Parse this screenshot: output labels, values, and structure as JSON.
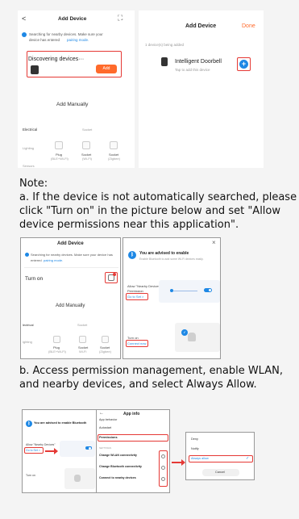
{
  "top_left": {
    "back": "<",
    "title": "Add Device",
    "scan": "⛶",
    "searching": "Searching for nearby devices. Make sure your",
    "searching2": "device has entered",
    "pairing_link": "pairing mode.",
    "discovering": "Discovering devices···",
    "add_btn": "Add",
    "add_manually": "Add Manually",
    "cat_electrical": "Electrical",
    "cat_socket": "Socket",
    "cat_lighting": "Lighting",
    "cat_sensors": "Sensors",
    "plug1": "Plug",
    "plug1_sub": "(BLE+Wi-Fi)",
    "plug2": "Socket",
    "plug2_sub": "(Wi-Fi)",
    "plug3": "Socket",
    "plug3_sub": "(Zigbee)"
  },
  "top_right": {
    "title": "Add Device",
    "done": "Done",
    "added": "1 device(s) being added",
    "device_name": "Intelligent Doorbell",
    "device_sub": "Tap to add this device",
    "add_icon": "+"
  },
  "note": {
    "heading": "Note:",
    "a_line1": "a. If the device is not automatically searched, please",
    "a_line2": "click \"Turn on\" in the picture below and set \"Allow",
    "a_line3": "device permissions near this application\".",
    "b_line1": "b. Access permission management, enable WLAN,",
    "b_line2": "and nearby devices, and select Always Allow."
  },
  "mid_left": {
    "title": "Add Device",
    "searching": "Searching for nearby devices. Make sure your device has",
    "searching2": "entered",
    "pairing_link": "pairing mode.",
    "turn_on": "Turn on",
    "add_manually": "Add Manually",
    "cat_electrical": "lectrical",
    "cat_socket": "Socket",
    "cat_lighting": "ighting",
    "plug1": "Plug",
    "plug1_sub": "(BLE+Wi-Fi)",
    "plug2": "Socket",
    "plug2_sub": "Wi-Fi",
    "plug3": "Socket",
    "plug3_sub": "(Zigbee)"
  },
  "mid_right": {
    "close": "×",
    "advised": "You are advised to enable",
    "advised_sub": "Enable Bluetooth to add some Wi-Fi devices easily.",
    "allow": "Allow \"Nearby Devices\"",
    "permission": "Permission",
    "go_to_set": "Go to Set >",
    "turn_on": "Turn on",
    "connect_now": "Connect now"
  },
  "bottom_left": {
    "advised": "You are advised to enable Bluetooth",
    "allow": "Allow \"Nearby Devices\"",
    "go_to_set": "Go to Set >",
    "turn_on": "Turn on"
  },
  "bottom_mid": {
    "back": "←",
    "title": "App info",
    "app_behavior": "App behavior",
    "autostart": "Autostart",
    "permissions": "Permissions",
    "settings": "SETTINGS",
    "wlan": "Change WLAN connectivity",
    "bluetooth": "Change Bluetooth connectivity",
    "nearby": "Connect to nearby devices"
  },
  "bottom_right": {
    "deny": "Deny",
    "notify": "Notify",
    "always_allow": "Always allow",
    "cancel": "Cancel"
  },
  "colors": {
    "accent_red": "#e53935",
    "orange": "#ff6a2b",
    "blue": "#1e88e5"
  }
}
